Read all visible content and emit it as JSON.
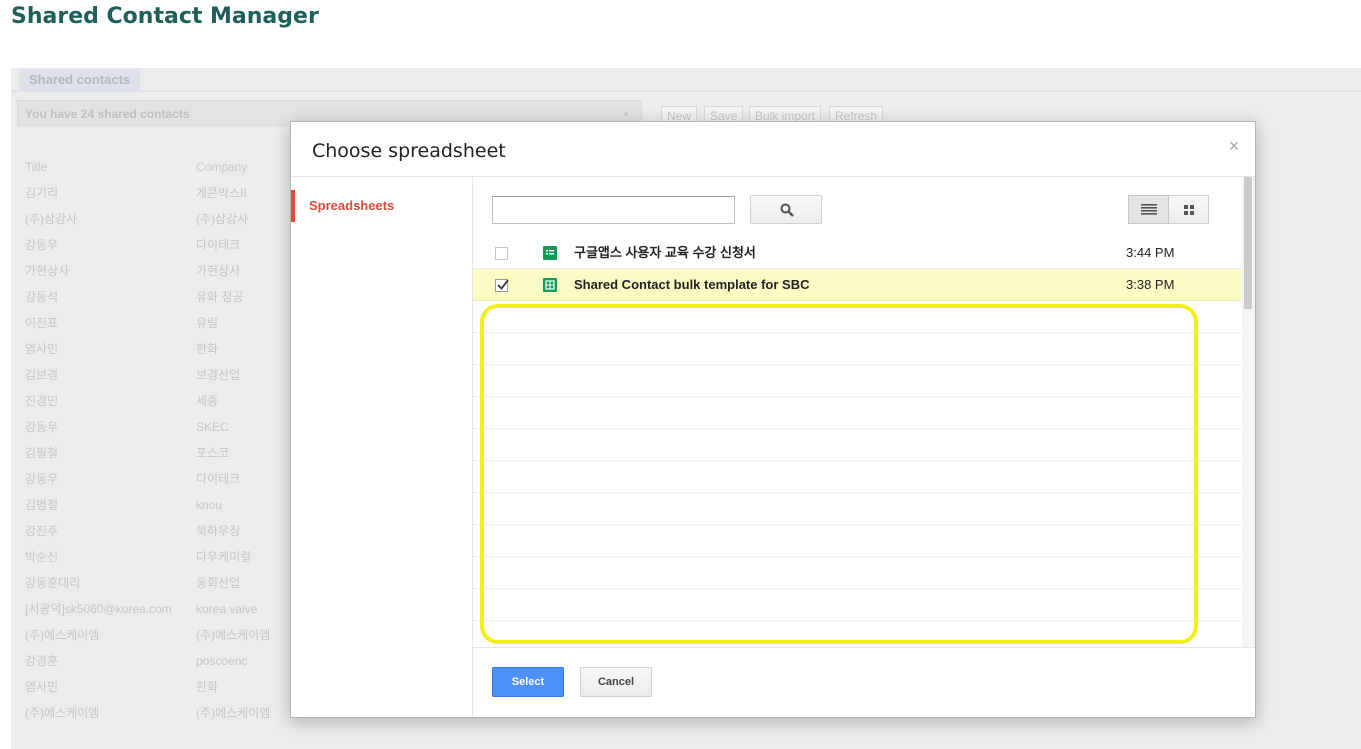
{
  "app": {
    "title": "Shared Contact Manager"
  },
  "background": {
    "tab_label": "Shared contacts",
    "count_text": "You have 24 shared contacts",
    "buttons": [
      "New",
      "Save",
      "Bulk import",
      "Refresh"
    ],
    "columns": [
      "Title",
      "Company"
    ],
    "rows": [
      [
        "김기리",
        "게콘박스II"
      ],
      [
        "(주)삼강사",
        "(주)삼강사"
      ],
      [
        "강동우",
        "다이테크"
      ],
      [
        "가현상사",
        "가현상사"
      ],
      [
        "강동석",
        "유화 청공"
      ],
      [
        "이진표",
        "유림"
      ],
      [
        "염사민",
        "한화"
      ],
      [
        "김보경",
        "보경산업"
      ],
      [
        "진경민",
        "세종"
      ],
      [
        "강동우",
        "SKEC"
      ],
      [
        "김필철",
        "포스코"
      ],
      [
        "강동우",
        "다이테크"
      ],
      [
        "김병철",
        "knou"
      ],
      [
        "강진주",
        "북하우징"
      ],
      [
        "박순신",
        "다우케미컬"
      ],
      [
        "강동훈대리",
        "동회산업"
      ],
      [
        "[서광덕]sk5060@korea.com",
        "korea valve"
      ],
      [
        "(주)에스케이엠",
        "(주)에스케이엠"
      ],
      [
        "강경훈",
        "poscoenc"
      ],
      [
        "염사민",
        "한화"
      ],
      [
        "(주)에스케이엠",
        "(주)에스케이엠"
      ]
    ]
  },
  "dialog": {
    "title": "Choose spreadsheet",
    "close_symbol": "×",
    "nav_item": "Spreadsheets",
    "search": {
      "placeholder": "",
      "value": ""
    },
    "files": [
      {
        "name": "구글앱스 사용자 교육 수강 신청서",
        "time": "3:44 PM",
        "checked": false
      },
      {
        "name": "Shared Contact bulk template for SBC",
        "time": "3:38 PM",
        "checked": true
      }
    ],
    "select_label": "Select",
    "cancel_label": "Cancel"
  },
  "colors": {
    "accent_red": "#dd4b39",
    "select_blue": "#4d90fe",
    "sheets_green": "#0f9d58",
    "selected_row": "#fdfbc4",
    "highlight_yellow": "#f4ef18",
    "app_title": "#1f5f5b"
  },
  "icons": [
    "search-icon",
    "list-view-icon",
    "grid-view-icon",
    "close-icon",
    "spreadsheet-icon",
    "checkbox-icon"
  ]
}
